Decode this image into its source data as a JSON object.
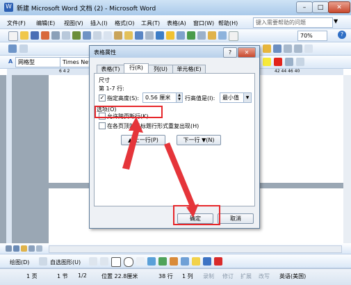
{
  "window": {
    "title": "新建 Microsoft Word 文档 (2) - Microsoft Word",
    "controls": {
      "minimize": "–",
      "maximize": "□",
      "close": "✕"
    }
  },
  "menu": {
    "items": [
      "文件(F)",
      "编辑(E)",
      "视图(V)",
      "插入(I)",
      "格式(O)",
      "工具(T)",
      "表格(A)",
      "窗口(W)",
      "帮助(H)"
    ],
    "help_placeholder": "键入需要帮助的问题"
  },
  "toolbar": {
    "zoom": "70%",
    "style_value": "网格型",
    "font_value": "Times New",
    "ruler_numbers_left": "6  4  2",
    "ruler_numbers_right": "42 44 46 40"
  },
  "dialog": {
    "title": "表格属性",
    "help_icon_label": "?",
    "close_label": "✕",
    "tabs": [
      "表格(T)",
      "行(R)",
      "列(U)",
      "单元格(E)"
    ],
    "active_tab": 1,
    "section_size": "尺寸",
    "row_label": "第 1-7 行:",
    "specify_height_label": "指定高度(S):",
    "specify_height_checked": true,
    "height_value": "0.56 厘米",
    "row_height_is_label": "行高值是(I):",
    "row_height_mode": "最小值",
    "section_options": "选项(O)",
    "allow_break_label": "允许跨页断行(K)",
    "allow_break_checked": false,
    "repeat_header_label": "在各页顶端以标题行形式重复出现(H)",
    "repeat_header_checked": false,
    "prev_row_label": "▲ 上一行(P)",
    "next_row_label": "下一行 ▼(N)",
    "ok_label": "确定",
    "cancel_label": "取消"
  },
  "drawing_toolbar": {
    "draw_label": "绘图(D)",
    "autoshape_label": "自选图形(U)"
  },
  "status": {
    "page": "1 页",
    "section": "1 节",
    "pages": "1/2",
    "position": "位置 22.8厘米",
    "line": "38 行",
    "column": "1 列",
    "rec": "录制",
    "trk": "修订",
    "ext": "扩展",
    "ovr": "改写",
    "language": "英语(美国)"
  },
  "colors": {
    "highlight_red": "#e6262a",
    "arrow_red": "#e5353a",
    "title_blue": "#b8d0ea"
  }
}
